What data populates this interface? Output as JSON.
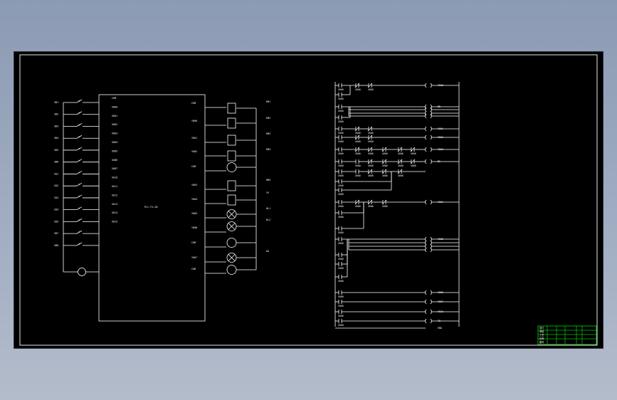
{
  "drawing": {
    "background": "#000000",
    "line_color": "#ffffff",
    "title_block_color": "#00c000",
    "plc_label": "PLC-FX-2N"
  },
  "inputs": {
    "left_labels": [
      "SB1",
      "SB2",
      "SB3",
      "SB4",
      "SB5",
      "SB6",
      "SQ1",
      "SQ2",
      "SQ3",
      "SQ4",
      "SQ5",
      "SB7",
      "SB8",
      "SB9"
    ],
    "plc_ports": [
      "COM",
      "X000",
      "X001",
      "X002",
      "X003",
      "X004",
      "X005",
      "X006",
      "X007",
      "X010",
      "X011",
      "X012",
      "X013",
      "X014",
      "X015"
    ]
  },
  "outputs": {
    "plc_ports": [
      "COM",
      "Y000",
      "Y001",
      "Y002",
      "COM",
      "Y003",
      "Y004",
      "Y005",
      "Y006",
      "COM",
      "Y007",
      "COM"
    ],
    "right_labels": [
      "KM1",
      "KM2",
      "KM3",
      "KM4",
      "KM5",
      "YV",
      "HL1",
      "HL2",
      "KA"
    ]
  },
  "ladder": {
    "coil_labels": [
      "Y000",
      "M0",
      "Y001",
      "Y002",
      "Y003",
      "M1",
      "Y004",
      "Y005",
      "Y006",
      "Y007",
      "Y010",
      "T0",
      "T1",
      "T2",
      "END"
    ],
    "contact_label": "X000"
  },
  "title_block": {
    "rows": [
      "设计",
      "审核",
      "工艺",
      "比例",
      "图号"
    ]
  }
}
